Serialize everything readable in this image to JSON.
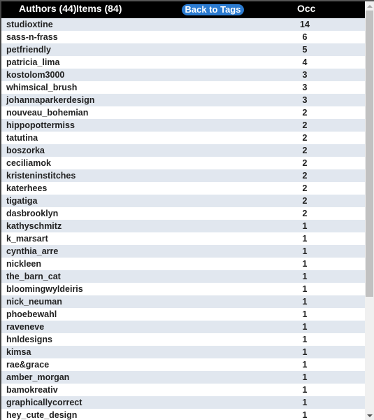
{
  "header": {
    "authors_label": "Authors (44)",
    "items_label": "Items (84)",
    "back_button": "Back to Tags",
    "occ_label": "Occ"
  },
  "rows": [
    {
      "name": "studioxtine",
      "occ": "14"
    },
    {
      "name": "sass-n-frass",
      "occ": "6"
    },
    {
      "name": "petfriendly",
      "occ": "5"
    },
    {
      "name": "patricia_lima",
      "occ": "4"
    },
    {
      "name": "kostolom3000",
      "occ": "3"
    },
    {
      "name": "whimsical_brush",
      "occ": "3"
    },
    {
      "name": "johannaparkerdesign",
      "occ": "3"
    },
    {
      "name": "nouveau_bohemian",
      "occ": "2"
    },
    {
      "name": "hippopottermiss",
      "occ": "2"
    },
    {
      "name": "tatutina",
      "occ": "2"
    },
    {
      "name": "boszorka",
      "occ": "2"
    },
    {
      "name": "ceciliamok",
      "occ": "2"
    },
    {
      "name": "kristeninstitches",
      "occ": "2"
    },
    {
      "name": "katerhees",
      "occ": "2"
    },
    {
      "name": "tigatiga",
      "occ": "2"
    },
    {
      "name": "dasbrooklyn",
      "occ": "2"
    },
    {
      "name": "kathyschmitz",
      "occ": "1"
    },
    {
      "name": "k_marsart",
      "occ": "1"
    },
    {
      "name": "cynthia_arre",
      "occ": "1"
    },
    {
      "name": "nickleen",
      "occ": "1"
    },
    {
      "name": "the_barn_cat",
      "occ": "1"
    },
    {
      "name": "bloomingwyldeiris",
      "occ": "1"
    },
    {
      "name": "nick_neuman",
      "occ": "1"
    },
    {
      "name": "phoebewahl",
      "occ": "1"
    },
    {
      "name": "raveneve",
      "occ": "1"
    },
    {
      "name": "hnldesigns",
      "occ": "1"
    },
    {
      "name": "kimsa",
      "occ": "1"
    },
    {
      "name": "rae&grace",
      "occ": "1"
    },
    {
      "name": "amber_morgan",
      "occ": "1"
    },
    {
      "name": "bamokreativ",
      "occ": "1"
    },
    {
      "name": "graphicallycorrect",
      "occ": "1"
    },
    {
      "name": "hey_cute_design",
      "occ": "1"
    }
  ]
}
